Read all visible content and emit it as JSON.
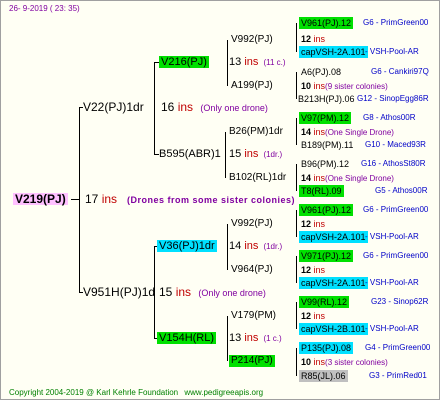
{
  "header": {
    "date": "26-  9-2019 (  23:  35)"
  },
  "footer": {
    "copyright": "Copyright 2004-2019 @ Karl Kehrle Foundation",
    "website": "www.pedigreeapis.org"
  },
  "root": {
    "name": "V219(PJ)",
    "ins_count": "17",
    "ins_label": "ins",
    "note": "(Drones from some sister colonies)"
  },
  "gen1": [
    {
      "name": "V22(PJ)1dr",
      "ins_count": "16",
      "ins_label": "ins",
      "note": "(Only one drone)"
    },
    {
      "name": "V951H(PJ)1d",
      "ins_count": "15",
      "ins_label": "ins",
      "note": "(Only one drone)"
    }
  ],
  "gen2": [
    {
      "name": "V216(PJ)",
      "ins_count": "13",
      "ins_label": "ins",
      "note": "(11 c.)"
    },
    {
      "name": "B595(ABR)1",
      "ins_count": "15",
      "ins_label": "ins",
      "note": "(1dr.)"
    },
    {
      "name": "V36(PJ)1dr",
      "ins_count": "14",
      "ins_label": "ins",
      "note": "(1dr.)"
    },
    {
      "name": "V154H(RL)",
      "ins_count": "13",
      "ins_label": "ins",
      "note": "(1 c.)"
    }
  ],
  "gen3": [
    {
      "name": "V992(PJ)",
      "ins_count": "",
      "ins_label": "",
      "note": ""
    },
    {
      "name": "A199(PJ)",
      "ins_count": "",
      "ins_label": "",
      "note": ""
    },
    {
      "name": "B26(PM)1dr",
      "ins_count": "",
      "ins_label": "",
      "note": ""
    },
    {
      "name": "B102(RL)1dr",
      "ins_count": "",
      "ins_label": "",
      "note": ""
    },
    {
      "name": "V992(PJ)",
      "ins_count": "",
      "ins_label": "",
      "note": ""
    },
    {
      "name": "V964(PJ)",
      "ins_count": "",
      "ins_label": "",
      "note": ""
    },
    {
      "name": "V179(PM)",
      "ins_count": "",
      "ins_label": "",
      "note": ""
    },
    {
      "name": "P214(PJ)",
      "ins_count": "",
      "ins_label": "",
      "note": ""
    }
  ],
  "gen3_mid": [
    {
      "ins_count": "13",
      "ins_label": "ins",
      "note": "(11 c.)"
    },
    {
      "ins_count": "14",
      "ins_label": "ins",
      "note": "(1dr.)"
    },
    {
      "ins_count": "",
      "ins_label": "",
      "note": ""
    },
    {
      "ins_count": "",
      "ins_label": "",
      "note": ""
    }
  ],
  "gen4": [
    {
      "id": "V961(PJ).12",
      "gen": "G6",
      "origin": "PrimGreen00"
    },
    {
      "id": "12",
      "ins": "ins",
      "note": ""
    },
    {
      "id": "capVSH-2A.101",
      "gen": "",
      "origin": "VSH-Pool-AR"
    },
    {
      "id": "A6(PJ).08",
      "gen": "G6",
      "origin": "Cankiri97Q"
    },
    {
      "id": "10",
      "ins": "ins",
      "note": "(9 sister colonies)"
    },
    {
      "id": "B213H(PJ).06",
      "gen": "G12",
      "origin": "SinopEgg86R"
    },
    {
      "id": "V97(PM).12",
      "gen": "G8",
      "origin": "Athos00R"
    },
    {
      "id": "14",
      "ins": "ins",
      "note": "(One Single Drone)"
    },
    {
      "id": "B189(PM).11",
      "gen": "G10",
      "origin": "Maced93R"
    },
    {
      "id": "B96(PM).12",
      "gen": "G16",
      "origin": "AthosSt80R"
    },
    {
      "id": "14",
      "ins": "ins",
      "note": "(One Single Drone)"
    },
    {
      "id": "T8(RL).09",
      "gen": "G5",
      "origin": "Athos00R"
    },
    {
      "id": "V961(PJ).12",
      "gen": "G6",
      "origin": "PrimGreen00"
    },
    {
      "id": "12",
      "ins": "ins",
      "note": ""
    },
    {
      "id": "capVSH-2A.101",
      "gen": "",
      "origin": "VSH-Pool-AR"
    },
    {
      "id": "V971(PJ).12",
      "gen": "G6",
      "origin": "PrimGreen00"
    },
    {
      "id": "12",
      "ins": "ins",
      "note": ""
    },
    {
      "id": "capVSH-2A.101",
      "gen": "",
      "origin": "VSH-Pool-AR"
    },
    {
      "id": "V99(RL).12",
      "gen": "G23",
      "origin": "Sinop62R"
    },
    {
      "id": "12",
      "ins": "ins",
      "note": ""
    },
    {
      "id": "capVSH-2B.101",
      "gen": "",
      "origin": "VSH-Pool-AR"
    },
    {
      "id": "P135(PJ).08",
      "gen": "G4",
      "origin": "PrimGreen00"
    },
    {
      "id": "10",
      "ins": "ins",
      "note": "(3 sister colonies)"
    },
    {
      "id": "R85(JL).06",
      "gen": "G3",
      "origin": "PrimRed01"
    }
  ]
}
